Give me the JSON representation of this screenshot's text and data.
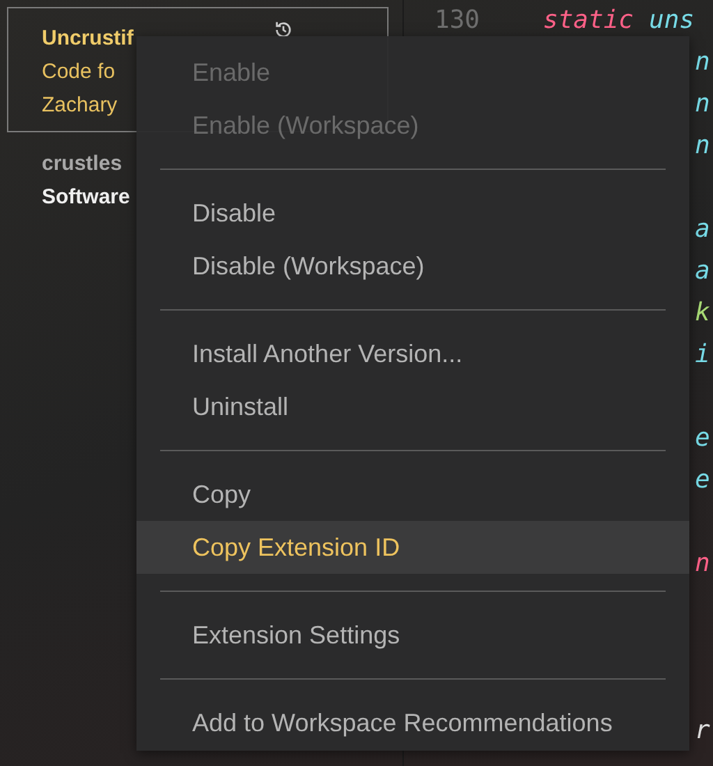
{
  "sidebar": {
    "extensions": [
      {
        "selected": true,
        "lines": [
          "Uncrustif",
          "Code fo",
          "Zachary"
        ]
      },
      {
        "selected": false,
        "lines": [
          "crustles",
          "Software"
        ]
      }
    ]
  },
  "editor": {
    "line_number": "130",
    "lines": [
      {
        "kind": "code",
        "tokens": [
          {
            "text": "static",
            "color": "#ff6188"
          },
          {
            "text": "uns",
            "color": "#78dce8"
          }
        ]
      },
      {
        "kind": "tail",
        "tokens": [
          {
            "text": "n",
            "color": "#78dce8"
          }
        ]
      },
      {
        "kind": "tail",
        "tokens": [
          {
            "text": "n",
            "color": "#78dce8"
          }
        ]
      },
      {
        "kind": "tail",
        "tokens": [
          {
            "text": "n",
            "color": "#78dce8"
          }
        ]
      },
      {
        "kind": "blank"
      },
      {
        "kind": "tail",
        "tokens": [
          {
            "text": "a",
            "color": "#78dce8"
          }
        ]
      },
      {
        "kind": "tail",
        "tokens": [
          {
            "text": "a",
            "color": "#78dce8"
          }
        ]
      },
      {
        "kind": "tail",
        "tokens": [
          {
            "text": "k",
            "color": "#a9dc76"
          }
        ]
      },
      {
        "kind": "tail",
        "tokens": [
          {
            "text": "i",
            "color": "#78dce8"
          }
        ]
      },
      {
        "kind": "blank"
      },
      {
        "kind": "tail",
        "tokens": [
          {
            "text": "e",
            "color": "#78dce8"
          }
        ]
      },
      {
        "kind": "tail",
        "tokens": [
          {
            "text": "e",
            "color": "#78dce8"
          }
        ]
      },
      {
        "kind": "blank"
      },
      {
        "kind": "tail",
        "tokens": [
          {
            "text": "n",
            "color": "#ff6188"
          }
        ]
      },
      {
        "kind": "blank"
      },
      {
        "kind": "blank"
      },
      {
        "kind": "blank"
      },
      {
        "kind": "tail",
        "tokens": [
          {
            "text": "r",
            "color": "#e0e0e0"
          }
        ]
      }
    ]
  },
  "context_menu": {
    "groups": [
      [
        {
          "label": "Enable",
          "disabled": true,
          "selected": false
        },
        {
          "label": "Enable (Workspace)",
          "disabled": true,
          "selected": false
        }
      ],
      [
        {
          "label": "Disable",
          "disabled": false,
          "selected": false
        },
        {
          "label": "Disable (Workspace)",
          "disabled": false,
          "selected": false
        }
      ],
      [
        {
          "label": "Install Another Version...",
          "disabled": false,
          "selected": false
        },
        {
          "label": "Uninstall",
          "disabled": false,
          "selected": false
        }
      ],
      [
        {
          "label": "Copy",
          "disabled": false,
          "selected": false
        },
        {
          "label": "Copy Extension ID",
          "disabled": false,
          "selected": true
        }
      ],
      [
        {
          "label": "Extension Settings",
          "disabled": false,
          "selected": false
        }
      ],
      [
        {
          "label": "Add to Workspace Recommendations",
          "disabled": false,
          "selected": false
        }
      ]
    ]
  }
}
